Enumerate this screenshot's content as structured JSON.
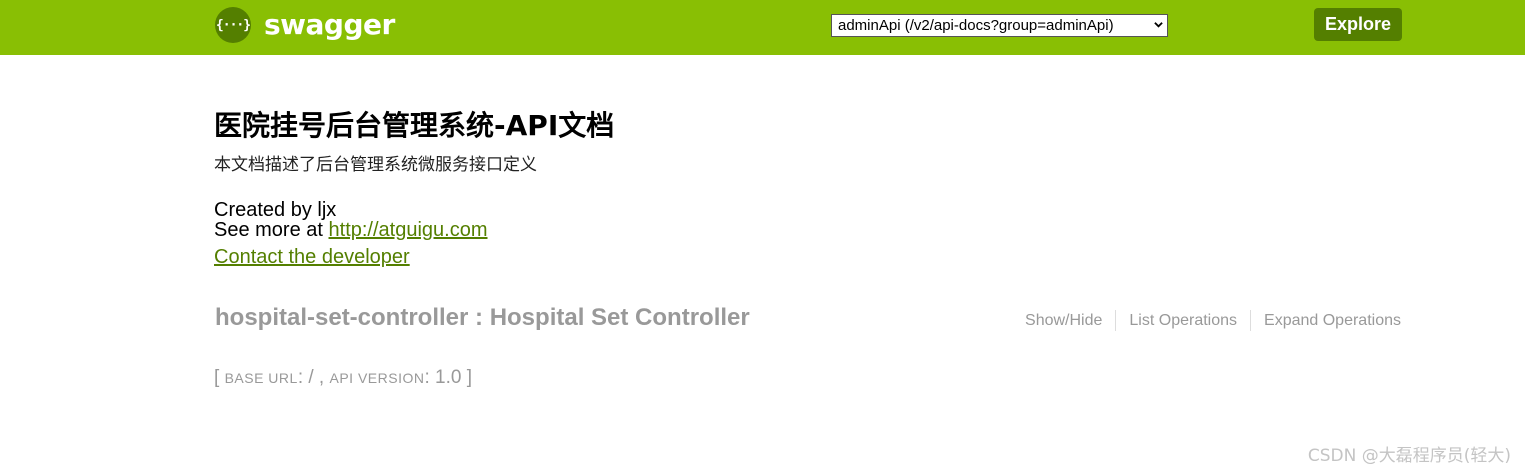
{
  "header": {
    "logo_symbol": "{···}",
    "logo_text": "swagger",
    "api_select": {
      "selected": "adminApi (/v2/api-docs?group=adminApi)"
    },
    "explore_label": "Explore",
    "colors": {
      "header_bg": "#89bf04",
      "button_bg": "#547f00"
    }
  },
  "info": {
    "title": "医院挂号后台管理系统-API文档",
    "description": "本文档描述了后台管理系统微服务接口定义",
    "created_by": "Created by ljx",
    "see_more_prefix": "See more at ",
    "see_more_link": "http://atguigu.com",
    "contact_label": "Contact the developer"
  },
  "resource": {
    "title": "hospital-set-controller : Hospital Set Controller",
    "operations": [
      "Show/Hide",
      "List Operations",
      "Expand Operations"
    ]
  },
  "footer": {
    "open_bracket": "[",
    "base_url_label": "base url",
    "base_url_value": ": / , ",
    "api_version_label": "api version",
    "api_version_value": ": 1.0 ",
    "close_bracket": "]"
  },
  "watermark": "CSDN @大磊程序员(轻大)"
}
